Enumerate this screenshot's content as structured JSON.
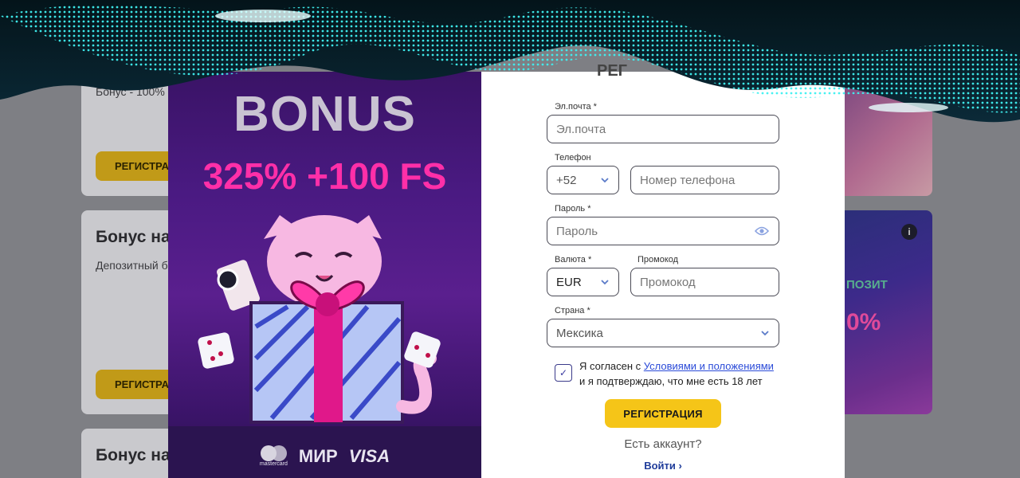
{
  "background": {
    "card1": {
      "text": "Бонус - 100%",
      "button": "РЕГИСТРА"
    },
    "card2": {
      "heading": "Бонус на",
      "sub": "Депозитный б",
      "button": "РЕГИСТРА"
    },
    "card3": {
      "heading": "Бонус на"
    },
    "right_card": {
      "deposit_label": "ПОЗИТ",
      "percent": "0%"
    }
  },
  "promo": {
    "bonus_word": "BONUS",
    "bonus_amount": "325% +100 FS",
    "payment_logos": [
      "mastercard",
      "МИР",
      "VISA"
    ]
  },
  "form": {
    "title_fragment": "РЕГ",
    "email": {
      "label": "Эл.почта *",
      "placeholder": "Эл.почта"
    },
    "phone": {
      "label": "Телефон",
      "code": "+52",
      "placeholder": "Номер телефона"
    },
    "password": {
      "label": "Пароль *",
      "placeholder": "Пароль"
    },
    "currency": {
      "label": "Валюта *",
      "value": "EUR"
    },
    "promocode": {
      "label": "Промокод",
      "placeholder": "Промокод"
    },
    "country": {
      "label": "Страна *",
      "value": "Мексика"
    },
    "agree": {
      "checked": true,
      "text_before": "Я согласен с ",
      "link": "Условиями и положениями",
      "text_after": "и я подтверждаю, что мне есть 18 лет"
    },
    "register_button": "РЕГИСТРАЦИЯ",
    "have_account": "Есть аккаунт?",
    "login_link": "Войти ›"
  },
  "colors": {
    "accent": "#f5c518",
    "link": "#2a4ad8",
    "promo_pink": "#ff2fa8",
    "promo_purple": "#4a1a82"
  }
}
